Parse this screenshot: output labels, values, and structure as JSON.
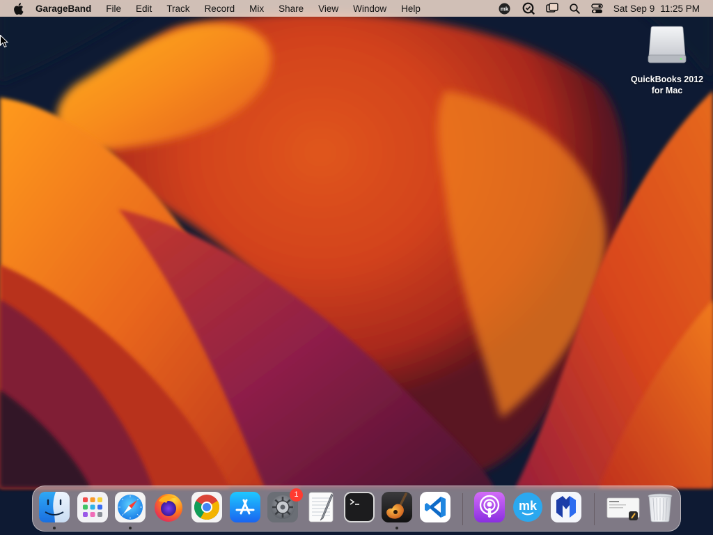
{
  "menubar": {
    "apple_icon": "apple-logo-icon",
    "app_name": "GarageBand",
    "menus": [
      {
        "id": "file",
        "label": "File"
      },
      {
        "id": "edit",
        "label": "Edit"
      },
      {
        "id": "track",
        "label": "Track"
      },
      {
        "id": "record",
        "label": "Record"
      },
      {
        "id": "mix",
        "label": "Mix"
      },
      {
        "id": "share",
        "label": "Share"
      },
      {
        "id": "view",
        "label": "View"
      },
      {
        "id": "window",
        "label": "Window"
      },
      {
        "id": "help",
        "label": "Help"
      }
    ],
    "status_icons": [
      "mk-app-icon",
      "qsearch-icon",
      "screen-mirroring-icon",
      "spotlight-search-icon",
      "control-center-icon"
    ],
    "clock": {
      "date": "Sat Sep 9",
      "time": "11:25 PM"
    }
  },
  "desktop": {
    "icons": [
      {
        "icon": "external-disk-icon",
        "label_line1": "QuickBooks 2012",
        "label_line2": "for Mac"
      }
    ]
  },
  "dock": {
    "apps": [
      {
        "name": "Finder",
        "icon": "finder-icon",
        "running": true
      },
      {
        "name": "Launchpad",
        "icon": "launchpad-icon",
        "running": false
      },
      {
        "name": "Safari",
        "icon": "safari-icon",
        "running": true
      },
      {
        "name": "Firefox",
        "icon": "firefox-icon",
        "running": false
      },
      {
        "name": "Google Chrome",
        "icon": "chrome-icon",
        "running": false
      },
      {
        "name": "App Store",
        "icon": "app-store-icon",
        "running": false
      },
      {
        "name": "System Settings",
        "icon": "system-settings-icon",
        "running": false,
        "badge": "1"
      },
      {
        "name": "TextEdit",
        "icon": "textedit-icon",
        "running": false
      },
      {
        "name": "Terminal",
        "icon": "terminal-icon",
        "running": false
      },
      {
        "name": "GarageBand",
        "icon": "garageband-icon",
        "running": true
      },
      {
        "name": "Visual Studio Code",
        "icon": "vscode-icon",
        "running": false
      },
      {
        "name": "Podcasts",
        "icon": "podcasts-icon",
        "running": false
      },
      {
        "name": "mk",
        "icon": "mk-icon",
        "running": false
      },
      {
        "name": "Malwarebytes",
        "icon": "malwarebytes-icon",
        "running": false
      }
    ],
    "others": [
      {
        "name": "Downloads",
        "icon": "downloads-stack-icon"
      },
      {
        "name": "Trash",
        "icon": "trash-icon"
      }
    ]
  },
  "colors": {
    "wallpaper_base": "#0e1a33",
    "wallpaper_orange": "#f08a1a",
    "wallpaper_red": "#c83a1e",
    "wallpaper_magenta": "#8a1f4a",
    "badge": "#ff3b30"
  }
}
